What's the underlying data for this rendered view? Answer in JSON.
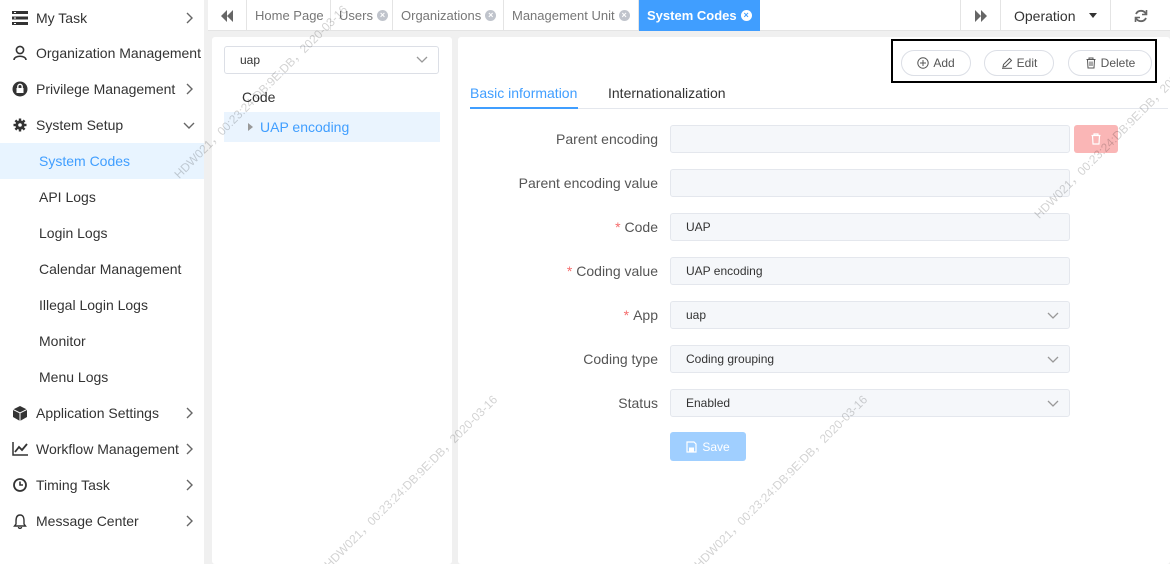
{
  "sidebar": {
    "items": [
      {
        "label": "My Task",
        "icon": "task-list-icon"
      },
      {
        "label": "Organization Management",
        "icon": "user-icon"
      },
      {
        "label": "Privilege Management",
        "icon": "lock-icon"
      },
      {
        "label": "System Setup",
        "icon": "gear-icon",
        "expanded": true
      },
      {
        "label": "Application Settings",
        "icon": "cube-icon"
      },
      {
        "label": "Workflow Management",
        "icon": "line-chart-icon"
      },
      {
        "label": "Timing Task",
        "icon": "clock-icon"
      },
      {
        "label": "Message Center",
        "icon": "bell-icon"
      }
    ],
    "subitems": [
      "System Codes",
      "API Logs",
      "Login Logs",
      "Calendar Management",
      "Illegal Login Logs",
      "Monitor",
      "Menu Logs"
    ],
    "active_sub": "System Codes"
  },
  "tabs": {
    "items": [
      "Home Page",
      "Users",
      "Organizations",
      "Management Unit",
      "System Codes"
    ],
    "active": "System Codes",
    "operation_label": "Operation"
  },
  "tree": {
    "select_value": "uap",
    "root_label": "Code",
    "node_label": "UAP encoding"
  },
  "actions": {
    "add": "Add",
    "edit": "Edit",
    "delete": "Delete"
  },
  "form_tabs": [
    "Basic information",
    "Internationalization"
  ],
  "form": {
    "parent_encoding": {
      "label": "Parent encoding",
      "value": ""
    },
    "parent_encoding_value": {
      "label": "Parent encoding value",
      "value": ""
    },
    "code": {
      "label": "Code",
      "value": "UAP",
      "required": true
    },
    "coding_value": {
      "label": "Coding value",
      "value": "UAP encoding",
      "required": true
    },
    "app": {
      "label": "App",
      "value": "uap",
      "required": true
    },
    "coding_type": {
      "label": "Coding type",
      "value": "Coding grouping"
    },
    "status": {
      "label": "Status",
      "value": "Enabled"
    },
    "save_label": "Save"
  },
  "watermark": [
    "HDW021，00:23:24:DB:9E:DB，2020-03-16"
  ],
  "colors": {
    "accent": "#409eff",
    "danger_light": "#fab6b6",
    "save_disabled": "#a0cfff"
  }
}
